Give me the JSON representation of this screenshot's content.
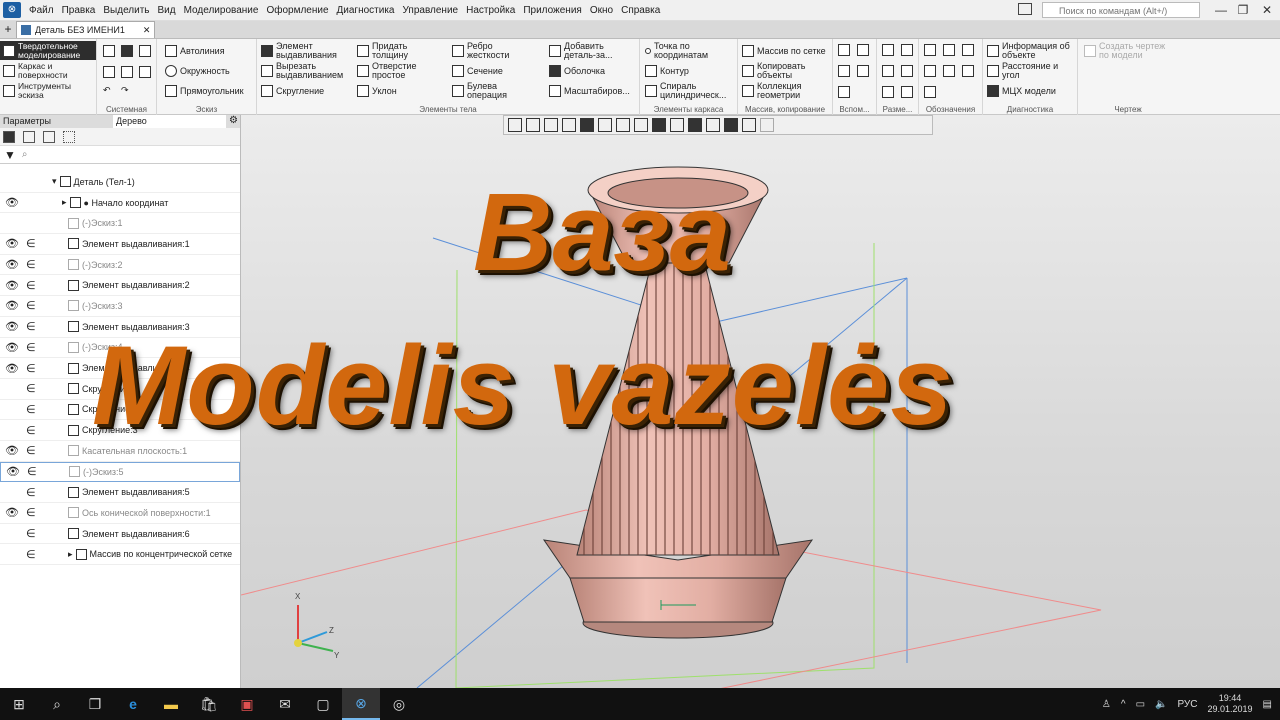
{
  "menu": [
    "Файл",
    "Правка",
    "Выделить",
    "Вид",
    "Моделирование",
    "Оформление",
    "Диагностика",
    "Управление",
    "Настройка",
    "Приложения",
    "Окно",
    "Справка"
  ],
  "search": {
    "placeholder": "Поиск по командам (Alt+/)"
  },
  "tab": {
    "title": "Деталь БЕЗ ИМЕНИ1"
  },
  "modes": [
    "Твердотельное моделирование",
    "Каркас и поверхности",
    "Инструменты эскиза"
  ],
  "ribbon": {
    "groups": [
      "Системная",
      "Эскиз",
      "Элементы тела",
      "Элементы каркаса",
      "Массив, копирование",
      "Вспом...",
      "Разме...",
      "Обозначения",
      "Диагностика",
      "Чертеж"
    ],
    "sketch": [
      "Автолиния",
      "Окружность",
      "Прямоугольник"
    ],
    "body": [
      "Элемент выдавливания",
      "Вырезать выдавливанием",
      "Скругление",
      "Придать толщину",
      "Отверстие простое",
      "Уклон",
      "Ребро жесткости",
      "Сечение",
      "Булева операция",
      "Добавить деталь-за...",
      "Оболочка",
      "Масштабиров..."
    ],
    "wire": [
      "Точка по координатам",
      "Контур",
      "Спираль цилиндрическ..."
    ],
    "array": [
      "Массив по сетке",
      "Копировать объекты",
      "Коллекция геометрии"
    ],
    "diag": [
      "Информация об объекте",
      "Расстояние и угол",
      "МЦХ модели"
    ],
    "drawing": [
      "Создать чертеж по модели"
    ]
  },
  "panel": {
    "tab1": "Параметры",
    "tab2": "Дерево"
  },
  "tree": [
    {
      "label": "Деталь (Тел-1)",
      "eye": "",
      "elem": ""
    },
    {
      "label": "● Начало координат",
      "eye": "👁",
      "elem": ""
    },
    {
      "label": "(-)Эскиз:1",
      "eye": "",
      "elem": "",
      "dim": true
    },
    {
      "label": "Элемент выдавливания:1",
      "eye": "👁",
      "elem": "∈"
    },
    {
      "label": "(-)Эскиз:2",
      "eye": "👁",
      "elem": "∈",
      "dim": true
    },
    {
      "label": "Элемент выдавливания:2",
      "eye": "👁",
      "elem": "∈"
    },
    {
      "label": "(-)Эскиз:3",
      "eye": "👁",
      "elem": "∈",
      "dim": true
    },
    {
      "label": "Элемент выдавливания:3",
      "eye": "👁",
      "elem": "∈"
    },
    {
      "label": "(-)Эскиз:4",
      "eye": "👁",
      "elem": "∈",
      "dim": true
    },
    {
      "label": "Элемент выдавливания:4",
      "eye": "👁",
      "elem": "∈"
    },
    {
      "label": "Скругление:1",
      "eye": "",
      "elem": "∈"
    },
    {
      "label": "Скругление:2",
      "eye": "",
      "elem": "∈"
    },
    {
      "label": "Скругление:3",
      "eye": "",
      "elem": "∈"
    },
    {
      "label": "Касательная плоскость:1",
      "eye": "👁",
      "elem": "∈",
      "dim": true
    },
    {
      "label": "(-)Эскиз:5",
      "eye": "👁",
      "elem": "∈",
      "dim": true
    },
    {
      "label": "Элемент выдавливания:5",
      "eye": "",
      "elem": "∈"
    },
    {
      "label": "Ось конической поверхности:1",
      "eye": "👁",
      "elem": "∈",
      "dim": true
    },
    {
      "label": "Элемент выдавливания:6",
      "eye": "",
      "elem": "∈"
    },
    {
      "label": "Массив по концентрической сетке",
      "eye": "",
      "elem": "∈"
    }
  ],
  "overlay": {
    "line1": "Ваза",
    "line2": "Modelis vazelės"
  },
  "axes": {
    "x": "X",
    "y": "Y",
    "z": "Z"
  },
  "tray": {
    "lang": "РУС",
    "time": "19:44",
    "date": "29.01.2019"
  },
  "colors": {
    "title_orange": "#d2680e",
    "vase": "#d9a79c",
    "taskbar": "#111111"
  }
}
